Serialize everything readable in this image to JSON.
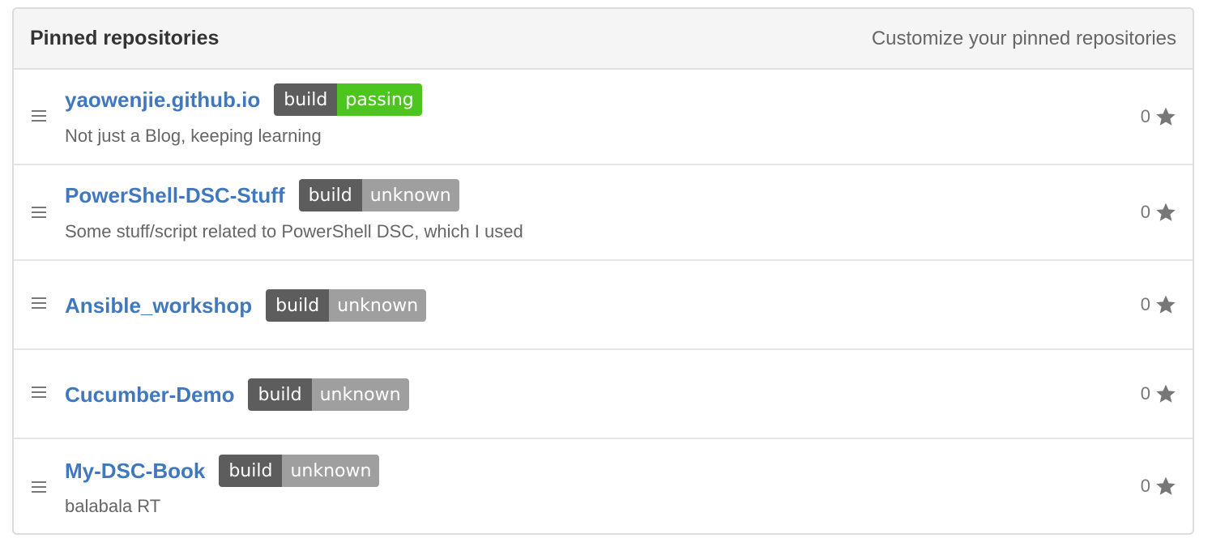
{
  "header": {
    "title": "Pinned repositories",
    "customize_link": "Customize your pinned repositories"
  },
  "repos": [
    {
      "name": "yaowenjie.github.io",
      "badge_label": "build",
      "badge_status": "passing",
      "badge_color": "#4cc61e",
      "description": "Not just a Blog, keeping learning",
      "stars": "0"
    },
    {
      "name": "PowerShell-DSC-Stuff",
      "badge_label": "build",
      "badge_status": "unknown",
      "badge_color": "#9f9f9f",
      "description": "Some stuff/script related to PowerShell DSC, which I used",
      "stars": "0"
    },
    {
      "name": "Ansible_workshop",
      "badge_label": "build",
      "badge_status": "unknown",
      "badge_color": "#9f9f9f",
      "description": "",
      "stars": "0"
    },
    {
      "name": "Cucumber-Demo",
      "badge_label": "build",
      "badge_status": "unknown",
      "badge_color": "#9f9f9f",
      "description": "",
      "stars": "0"
    },
    {
      "name": "My-DSC-Book",
      "badge_label": "build",
      "badge_status": "unknown",
      "badge_color": "#9f9f9f",
      "description": "balabala RT",
      "stars": "0"
    }
  ],
  "icons": {
    "drag": "drag-handle-icon",
    "star": "star-icon"
  }
}
